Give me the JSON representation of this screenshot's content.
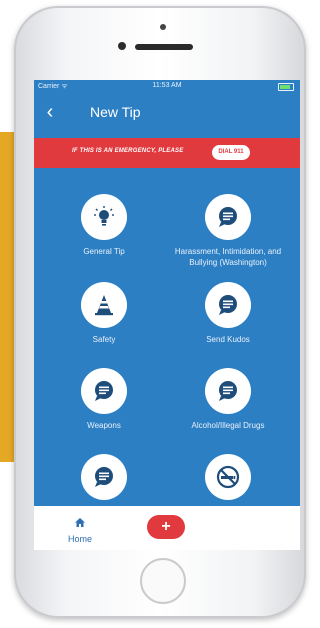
{
  "status": {
    "carrier": "Carrier ᯤ",
    "time": "11:53 AM"
  },
  "nav": {
    "back": "‹",
    "title": "New Tip"
  },
  "banner": {
    "text": "IF THIS IS AN EMERGENCY, PLEASE",
    "dial_label": "DIAL 911"
  },
  "categories": [
    {
      "label": "General Tip",
      "icon": "lightbulb-icon"
    },
    {
      "label": "Harassment, Intimidation, and Bullying (Washington)",
      "icon": "chat-bubble-icon"
    },
    {
      "label": "Safety",
      "icon": "traffic-cone-icon"
    },
    {
      "label": "Send Kudos",
      "icon": "chat-bubble-icon"
    },
    {
      "label": "Weapons",
      "icon": "chat-bubble-icon"
    },
    {
      "label": "Alcohol/Illegal Drugs",
      "icon": "chat-bubble-icon"
    },
    {
      "label": "",
      "icon": "chat-bubble-icon"
    },
    {
      "label": "",
      "icon": "no-smoking-icon"
    }
  ],
  "tabbar": {
    "home_label": "Home",
    "add_label": "+"
  },
  "colors": {
    "screen": "#2d7fc4",
    "accent_red": "#e13a3e",
    "tab_blue": "#2d6fb3"
  }
}
